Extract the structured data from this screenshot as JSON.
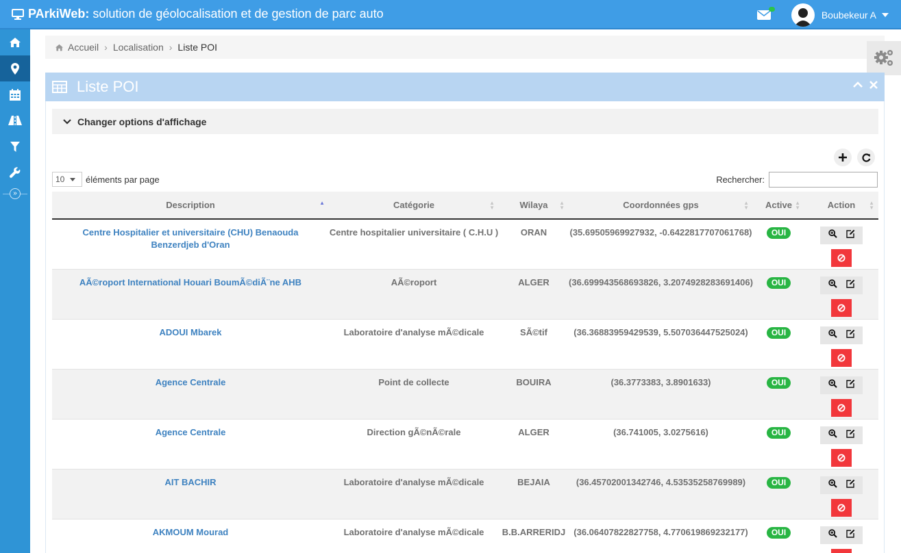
{
  "app": {
    "brand_bold": "PArkiWeb:",
    "brand_text": "solution de géolocalisation et de gestion de parc auto",
    "user": "Boubekeur A"
  },
  "sidebar": {
    "items": [
      "home-icon",
      "map-marker-icon",
      "calendar-icon",
      "road-icon",
      "filter-icon",
      "wrench-icon"
    ],
    "toggle": "»"
  },
  "breadcrumb": [
    "Accueil",
    "Localisation",
    "Liste POI"
  ],
  "widget": {
    "title": "Liste POI",
    "options_label": "Changer options d'affichage"
  },
  "table_controls": {
    "page_size": "10",
    "page_size_label": "éléments par page",
    "search_label": "Rechercher:",
    "search_value": ""
  },
  "table": {
    "columns": [
      "Description",
      "Catégorie",
      "Wilaya",
      "Coordonnées gps",
      "Active",
      "Action"
    ],
    "rows": [
      {
        "description": "Centre Hospitalier et universitaire (CHU) Benaouda Benzerdjeb d'Oran",
        "category": "Centre hospitalier universitaire ( C.H.U )",
        "wilaya": "ORAN",
        "gps": "(35.69505969927932, -0.6422817707061768)",
        "active": "OUI"
      },
      {
        "description": "AÃ©roport International Houari BoumÃ©diÃ¨ne AHB",
        "category": "AÃ©roport",
        "wilaya": "ALGER",
        "gps": "(36.699943568693826, 3.2074928283691406)",
        "active": "OUI"
      },
      {
        "description": "ADOUI Mbarek",
        "category": "Laboratoire d'analyse mÃ©dicale",
        "wilaya": "SÃ©tif",
        "gps": "(36.36883959429539, 5.507036447525024)",
        "active": "OUI"
      },
      {
        "description": "Agence Centrale",
        "category": "Point de collecte",
        "wilaya": "BOUIRA",
        "gps": "(36.3773383, 3.8901633)",
        "active": "OUI"
      },
      {
        "description": "Agence Centrale",
        "category": "Direction gÃ©nÃ©rale",
        "wilaya": "ALGER",
        "gps": "(36.741005, 3.0275616)",
        "active": "OUI"
      },
      {
        "description": "AIT BACHIR",
        "category": "Laboratoire d'analyse mÃ©dicale",
        "wilaya": "BEJAIA",
        "gps": "(36.45702001342746, 4.53535258769989)",
        "active": "OUI"
      },
      {
        "description": "AKMOUM Mourad",
        "category": "Laboratoire d'analyse mÃ©dicale",
        "wilaya": "B.B.ARRERIDJ",
        "gps": "(36.06407822827758, 4.770619869232177)",
        "active": "OUI"
      }
    ]
  },
  "colors": {
    "topbar": "#3f9de6",
    "sidebar": "#2f94d6",
    "sidebar_active": "#16639b",
    "widget_header": "#b8d5f2",
    "link": "#3e82c0",
    "badge_green": "#28b543",
    "delete_red": "#f2373b"
  }
}
